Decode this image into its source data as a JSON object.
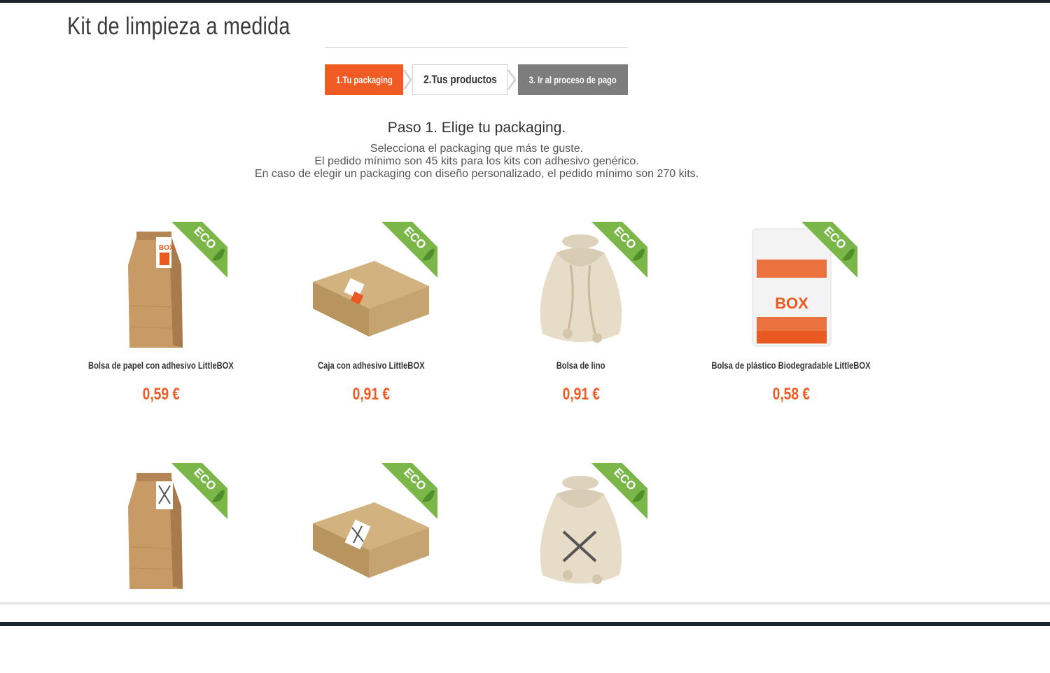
{
  "header": {
    "title": "Kit de limpieza a medida"
  },
  "stepper": {
    "steps": [
      {
        "label": "1.Tu packaging",
        "state": "active"
      },
      {
        "label": "2.Tus productos",
        "state": "pending"
      },
      {
        "label": "3. Ir al proceso de pago",
        "state": "disabled"
      }
    ]
  },
  "intro": {
    "heading": "Paso 1. Elige tu packaging.",
    "lines": [
      "Selecciona el packaging que más te guste.",
      "El pedido mínimo son 45 kits para los kits con adhesivo genérico.",
      "En caso de elegir un packaging con diseño personalizado, el pedido mínimo son 270 kits."
    ]
  },
  "badge": {
    "label": "ECO",
    "color": "#7ab648"
  },
  "colors": {
    "accent": "#f05a23",
    "step_inactive": "#7d7d7d",
    "kraft": "#c89a66",
    "linen": "#e6dcc8"
  },
  "products": [
    {
      "name": "Bolsa de papel con adhesivo LittleBOX",
      "price": "0,59 €",
      "image": "paper-bag-littlebox",
      "eco": true
    },
    {
      "name": "Caja con adhesivo LittleBOX",
      "price": "0,91 €",
      "image": "box-littlebox",
      "eco": true
    },
    {
      "name": "Bolsa de lino",
      "price": "0,91 €",
      "image": "linen-bag",
      "eco": true
    },
    {
      "name": "Bolsa de plástico Biodegradable LittleBOX",
      "price": "0,58 €",
      "image": "plastic-bag-littlebox",
      "eco": true
    },
    {
      "name": "",
      "price": "",
      "image": "paper-bag-custom",
      "eco": true
    },
    {
      "name": "",
      "price": "",
      "image": "box-custom",
      "eco": true
    },
    {
      "name": "",
      "price": "",
      "image": "linen-bag-custom",
      "eco": true
    }
  ]
}
